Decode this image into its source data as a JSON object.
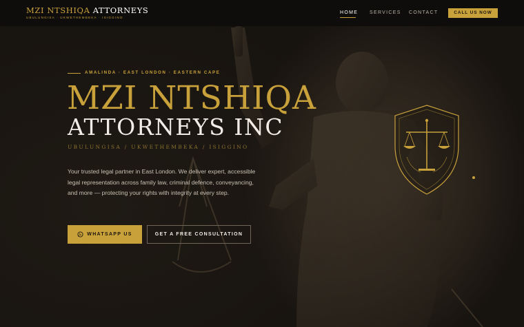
{
  "brand": {
    "name_gold": "MZI NTSHIQA",
    "name_white": "ATTORNEYS",
    "tagline": "UBULUNGISA · UKWETHEMBEKA · ISIGGINO"
  },
  "nav": {
    "links": [
      "HOME",
      "SERVICES",
      "CONTACT"
    ],
    "active": "HOME",
    "cta": "CALL US NOW"
  },
  "hero": {
    "eyebrow": "AMALINDA · EAST LONDON · EASTERN CAPE",
    "title_line1": "MZI NTSHIQA",
    "title_line2": "ATTORNEYS INC",
    "tagline": "UBULUNGISA  /  UKWETHEMBEKA  /  ISIGGINO",
    "description": "Your trusted legal partner in East London. We deliver expert, accessible legal representation across family law, criminal defence, conveyancing, and more — protecting your rights with integrity at every step.",
    "whatsapp_button": "WHATSAPP US",
    "consult_button": "GET A FREE CONSULTATION"
  },
  "icons": {
    "whatsapp": "whatsapp-icon",
    "emblem": "scales-of-justice-icon"
  },
  "colors": {
    "accent_gold": "#c9a13b",
    "background": "#1a1611",
    "nav_background": "#0f0d0b"
  }
}
